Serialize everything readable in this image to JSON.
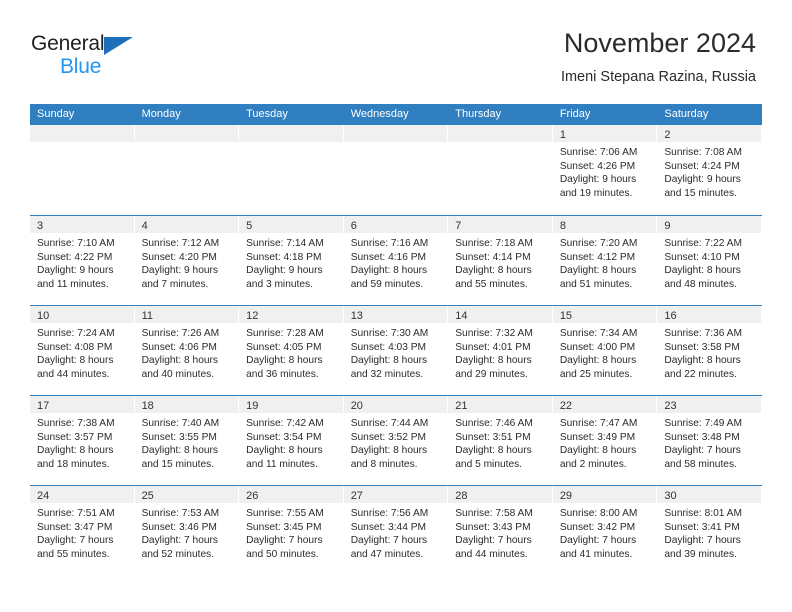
{
  "brand": {
    "name_top": "General",
    "name_bottom": "Blue",
    "accent_color": "#1e6fba",
    "blue_text_color": "#2196f3"
  },
  "header": {
    "title": "November 2024",
    "subtitle": "Imeni Stepana Razina, Russia"
  },
  "theme": {
    "header_row_bg": "#2f7fc1",
    "daynum_band_bg": "#f0f0f0",
    "grid_line": "#2f7fc1",
    "text": "#2b2b2b"
  },
  "weekdays": [
    "Sunday",
    "Monday",
    "Tuesday",
    "Wednesday",
    "Thursday",
    "Friday",
    "Saturday"
  ],
  "weeks": [
    [
      {
        "empty": true
      },
      {
        "empty": true
      },
      {
        "empty": true
      },
      {
        "empty": true
      },
      {
        "empty": true
      },
      {
        "day": "1",
        "sunrise": "Sunrise: 7:06 AM",
        "sunset": "Sunset: 4:26 PM",
        "daylight1": "Daylight: 9 hours",
        "daylight2": "and 19 minutes."
      },
      {
        "day": "2",
        "sunrise": "Sunrise: 7:08 AM",
        "sunset": "Sunset: 4:24 PM",
        "daylight1": "Daylight: 9 hours",
        "daylight2": "and 15 minutes."
      }
    ],
    [
      {
        "day": "3",
        "sunrise": "Sunrise: 7:10 AM",
        "sunset": "Sunset: 4:22 PM",
        "daylight1": "Daylight: 9 hours",
        "daylight2": "and 11 minutes."
      },
      {
        "day": "4",
        "sunrise": "Sunrise: 7:12 AM",
        "sunset": "Sunset: 4:20 PM",
        "daylight1": "Daylight: 9 hours",
        "daylight2": "and 7 minutes."
      },
      {
        "day": "5",
        "sunrise": "Sunrise: 7:14 AM",
        "sunset": "Sunset: 4:18 PM",
        "daylight1": "Daylight: 9 hours",
        "daylight2": "and 3 minutes."
      },
      {
        "day": "6",
        "sunrise": "Sunrise: 7:16 AM",
        "sunset": "Sunset: 4:16 PM",
        "daylight1": "Daylight: 8 hours",
        "daylight2": "and 59 minutes."
      },
      {
        "day": "7",
        "sunrise": "Sunrise: 7:18 AM",
        "sunset": "Sunset: 4:14 PM",
        "daylight1": "Daylight: 8 hours",
        "daylight2": "and 55 minutes."
      },
      {
        "day": "8",
        "sunrise": "Sunrise: 7:20 AM",
        "sunset": "Sunset: 4:12 PM",
        "daylight1": "Daylight: 8 hours",
        "daylight2": "and 51 minutes."
      },
      {
        "day": "9",
        "sunrise": "Sunrise: 7:22 AM",
        "sunset": "Sunset: 4:10 PM",
        "daylight1": "Daylight: 8 hours",
        "daylight2": "and 48 minutes."
      }
    ],
    [
      {
        "day": "10",
        "sunrise": "Sunrise: 7:24 AM",
        "sunset": "Sunset: 4:08 PM",
        "daylight1": "Daylight: 8 hours",
        "daylight2": "and 44 minutes."
      },
      {
        "day": "11",
        "sunrise": "Sunrise: 7:26 AM",
        "sunset": "Sunset: 4:06 PM",
        "daylight1": "Daylight: 8 hours",
        "daylight2": "and 40 minutes."
      },
      {
        "day": "12",
        "sunrise": "Sunrise: 7:28 AM",
        "sunset": "Sunset: 4:05 PM",
        "daylight1": "Daylight: 8 hours",
        "daylight2": "and 36 minutes."
      },
      {
        "day": "13",
        "sunrise": "Sunrise: 7:30 AM",
        "sunset": "Sunset: 4:03 PM",
        "daylight1": "Daylight: 8 hours",
        "daylight2": "and 32 minutes."
      },
      {
        "day": "14",
        "sunrise": "Sunrise: 7:32 AM",
        "sunset": "Sunset: 4:01 PM",
        "daylight1": "Daylight: 8 hours",
        "daylight2": "and 29 minutes."
      },
      {
        "day": "15",
        "sunrise": "Sunrise: 7:34 AM",
        "sunset": "Sunset: 4:00 PM",
        "daylight1": "Daylight: 8 hours",
        "daylight2": "and 25 minutes."
      },
      {
        "day": "16",
        "sunrise": "Sunrise: 7:36 AM",
        "sunset": "Sunset: 3:58 PM",
        "daylight1": "Daylight: 8 hours",
        "daylight2": "and 22 minutes."
      }
    ],
    [
      {
        "day": "17",
        "sunrise": "Sunrise: 7:38 AM",
        "sunset": "Sunset: 3:57 PM",
        "daylight1": "Daylight: 8 hours",
        "daylight2": "and 18 minutes."
      },
      {
        "day": "18",
        "sunrise": "Sunrise: 7:40 AM",
        "sunset": "Sunset: 3:55 PM",
        "daylight1": "Daylight: 8 hours",
        "daylight2": "and 15 minutes."
      },
      {
        "day": "19",
        "sunrise": "Sunrise: 7:42 AM",
        "sunset": "Sunset: 3:54 PM",
        "daylight1": "Daylight: 8 hours",
        "daylight2": "and 11 minutes."
      },
      {
        "day": "20",
        "sunrise": "Sunrise: 7:44 AM",
        "sunset": "Sunset: 3:52 PM",
        "daylight1": "Daylight: 8 hours",
        "daylight2": "and 8 minutes."
      },
      {
        "day": "21",
        "sunrise": "Sunrise: 7:46 AM",
        "sunset": "Sunset: 3:51 PM",
        "daylight1": "Daylight: 8 hours",
        "daylight2": "and 5 minutes."
      },
      {
        "day": "22",
        "sunrise": "Sunrise: 7:47 AM",
        "sunset": "Sunset: 3:49 PM",
        "daylight1": "Daylight: 8 hours",
        "daylight2": "and 2 minutes."
      },
      {
        "day": "23",
        "sunrise": "Sunrise: 7:49 AM",
        "sunset": "Sunset: 3:48 PM",
        "daylight1": "Daylight: 7 hours",
        "daylight2": "and 58 minutes."
      }
    ],
    [
      {
        "day": "24",
        "sunrise": "Sunrise: 7:51 AM",
        "sunset": "Sunset: 3:47 PM",
        "daylight1": "Daylight: 7 hours",
        "daylight2": "and 55 minutes."
      },
      {
        "day": "25",
        "sunrise": "Sunrise: 7:53 AM",
        "sunset": "Sunset: 3:46 PM",
        "daylight1": "Daylight: 7 hours",
        "daylight2": "and 52 minutes."
      },
      {
        "day": "26",
        "sunrise": "Sunrise: 7:55 AM",
        "sunset": "Sunset: 3:45 PM",
        "daylight1": "Daylight: 7 hours",
        "daylight2": "and 50 minutes."
      },
      {
        "day": "27",
        "sunrise": "Sunrise: 7:56 AM",
        "sunset": "Sunset: 3:44 PM",
        "daylight1": "Daylight: 7 hours",
        "daylight2": "and 47 minutes."
      },
      {
        "day": "28",
        "sunrise": "Sunrise: 7:58 AM",
        "sunset": "Sunset: 3:43 PM",
        "daylight1": "Daylight: 7 hours",
        "daylight2": "and 44 minutes."
      },
      {
        "day": "29",
        "sunrise": "Sunrise: 8:00 AM",
        "sunset": "Sunset: 3:42 PM",
        "daylight1": "Daylight: 7 hours",
        "daylight2": "and 41 minutes."
      },
      {
        "day": "30",
        "sunrise": "Sunrise: 8:01 AM",
        "sunset": "Sunset: 3:41 PM",
        "daylight1": "Daylight: 7 hours",
        "daylight2": "and 39 minutes."
      }
    ]
  ]
}
